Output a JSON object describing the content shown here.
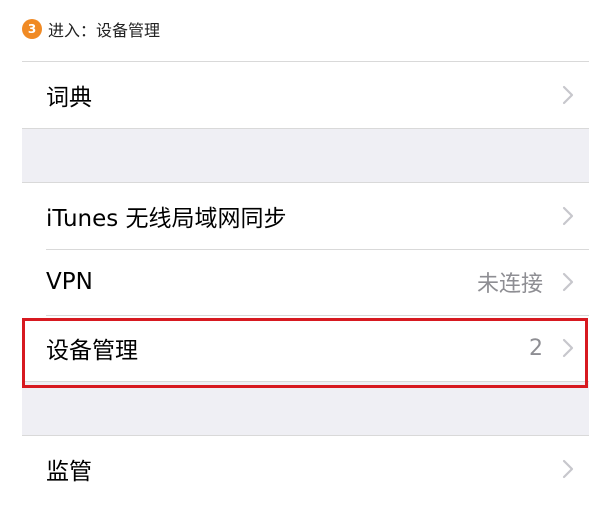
{
  "step": {
    "number": "3",
    "text": "进入：设备管理"
  },
  "colors": {
    "badge": "#f08a24",
    "highlight": "#d71920",
    "value_gray": "#8e8e93",
    "section_bg": "#efeff4"
  },
  "settings": {
    "dictionary": {
      "label": "词典"
    },
    "itunes_sync": {
      "label": "iTunes 无线局域网同步"
    },
    "vpn": {
      "label": "VPN",
      "value": "未连接"
    },
    "device_management": {
      "label": "设备管理",
      "value": "2",
      "highlighted": true
    },
    "supervision": {
      "label": "监管"
    }
  },
  "icons": {
    "chevron": "chevron-right-icon"
  }
}
